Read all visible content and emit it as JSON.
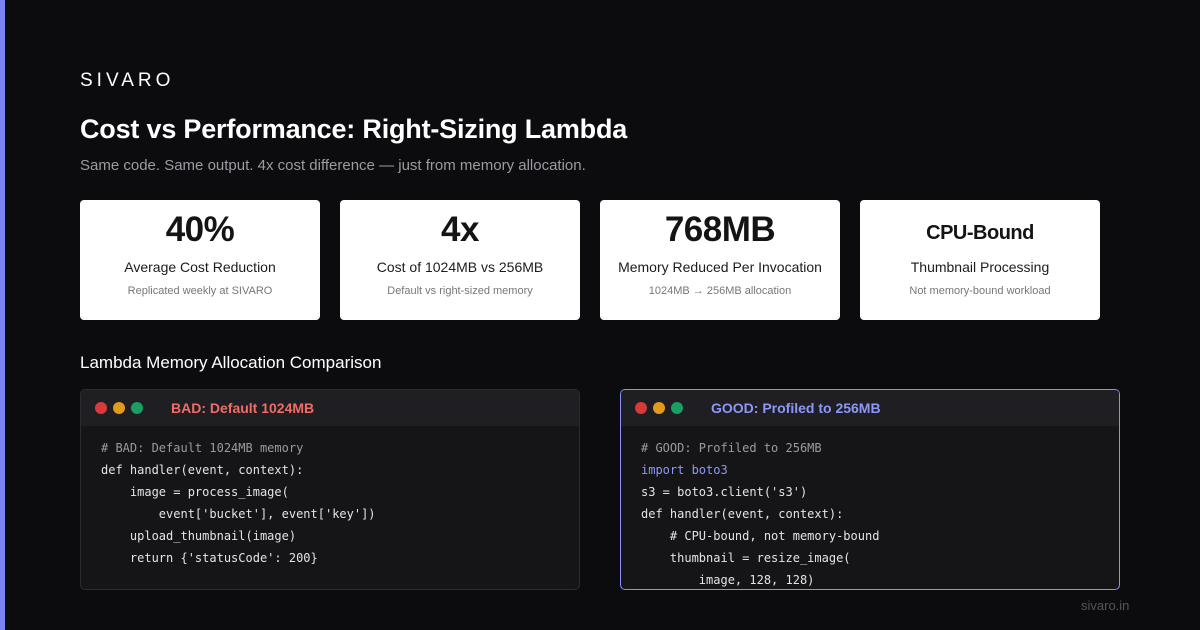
{
  "brand": "SIVARO",
  "title": "Cost vs Performance: Right-Sizing Lambda",
  "subtitle": "Same code. Same output. 4x cost difference — just from memory allocation.",
  "stats": [
    {
      "value": "40%",
      "label": "Average Cost Reduction",
      "note": "Replicated weekly at SIVARO"
    },
    {
      "value": "4x",
      "label": "Cost of 1024MB vs 256MB",
      "note": "Default vs right-sized memory"
    },
    {
      "value": "768MB",
      "label": "Memory Reduced Per Invocation",
      "note": "1024MB → 256MB allocation"
    },
    {
      "value": "CPU-Bound",
      "label": "Thumbnail Processing",
      "note": "Not memory-bound workload"
    }
  ],
  "section_title": "Lambda Memory Allocation Comparison",
  "panels": {
    "bad": {
      "title": "BAD: Default 1024MB",
      "lines": [
        "# BAD: Default 1024MB memory",
        "def handler(event, context):",
        "    image = process_image(",
        "        event['bucket'], event['key'])",
        "    upload_thumbnail(image)",
        "    return {'statusCode': 200}"
      ]
    },
    "good": {
      "title": "GOOD: Profiled to 256MB",
      "lines": [
        "# GOOD: Profiled to 256MB",
        "import boto3",
        "s3 = boto3.client('s3')",
        "def handler(event, context):",
        "    # CPU-bound, not memory-bound",
        "    thumbnail = resize_image(",
        "        image, 128, 128)"
      ]
    }
  },
  "footer": "sivaro.in",
  "colors": {
    "accent": "#7b83f2",
    "bad": "#f06d66",
    "good": "#8e97f7",
    "background": "#0c0c0e"
  },
  "icons": {
    "window_controls": [
      "red-dot-icon",
      "yellow-dot-icon",
      "green-dot-icon"
    ]
  }
}
